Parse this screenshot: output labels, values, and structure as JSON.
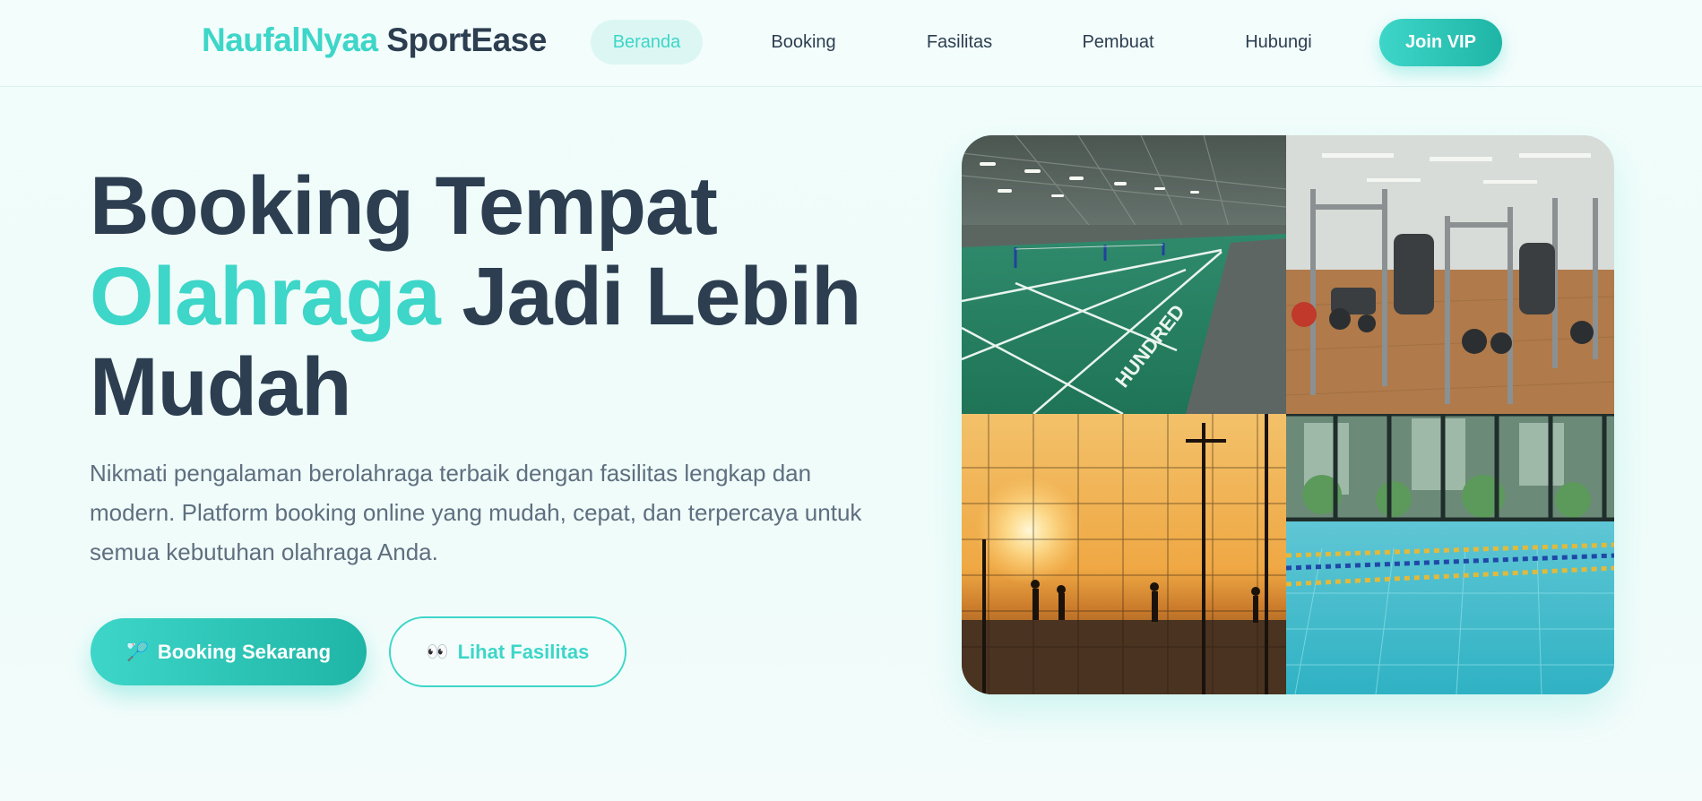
{
  "navbar": {
    "logo_part1": "NaufalNyaa",
    "logo_part2": "SportEase",
    "items": [
      {
        "label": "Beranda",
        "active": true
      },
      {
        "label": "Booking",
        "active": false
      },
      {
        "label": "Fasilitas",
        "active": false
      },
      {
        "label": "Pembuat",
        "active": false
      },
      {
        "label": "Hubungi",
        "active": false
      }
    ],
    "cta_label": "Join VIP"
  },
  "hero": {
    "title_line1": "Booking Tempat",
    "title_accent": "Olahraga",
    "title_line2_rest": "Jadi Lebih",
    "title_line3": "Mudah",
    "description": "Nikmati pengalaman berolahraga terbaik dengan fasilitas lengkap dan modern. Platform booking online yang mudah, cepat, dan terpercaya untuk semua kebutuhan olahraga Anda.",
    "primary_button": {
      "icon": "🏸",
      "label": "Booking Sekarang"
    },
    "secondary_button": {
      "icon": "👀",
      "label": "Lihat Fasilitas"
    }
  },
  "gallery": {
    "court_sign": "HUNDRED"
  },
  "colors": {
    "accent": "#3dd6c8",
    "accent_dark": "#1fb5a6",
    "text_dark": "#2c3e50",
    "text_muted": "#5f6f7f",
    "background": "#f1fdfb"
  }
}
